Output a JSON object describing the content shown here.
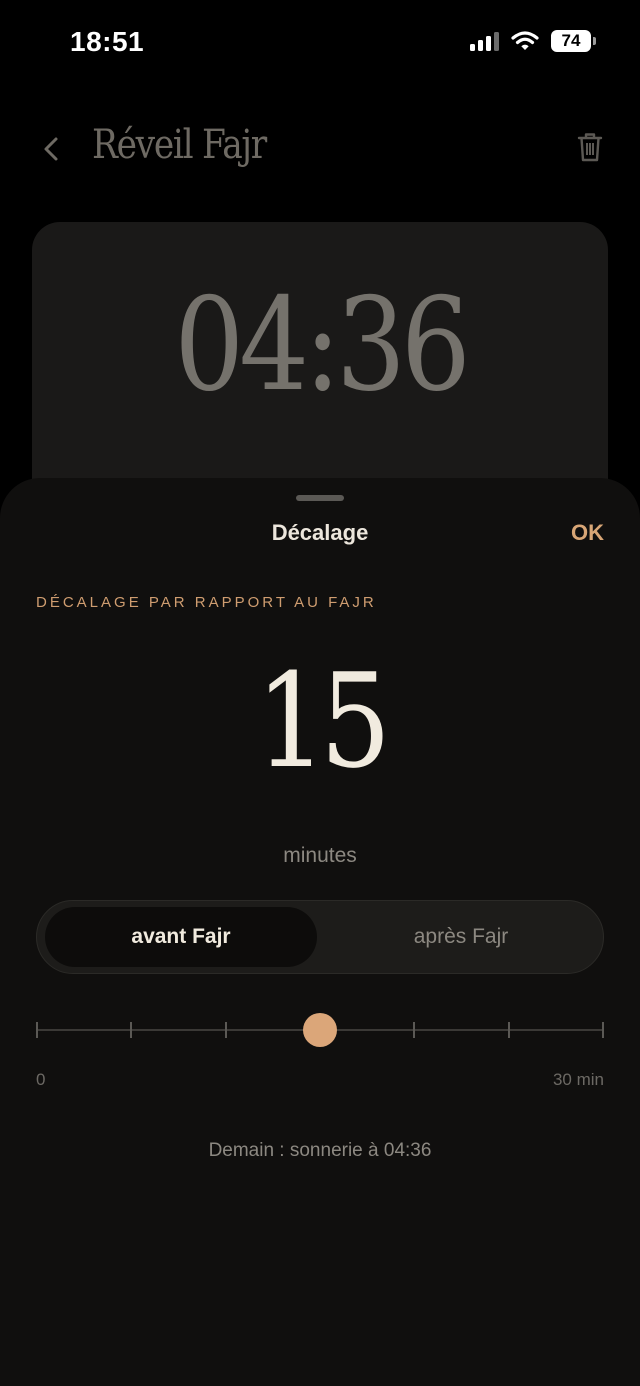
{
  "status_bar": {
    "time": "18:51",
    "battery": "74",
    "icons": [
      "cellular-signal-icon",
      "wifi-icon",
      "battery-icon"
    ]
  },
  "header": {
    "back_icon": "chevron-left-icon",
    "title": "Réveil Fajr",
    "delete_icon": "trash-icon"
  },
  "alarm": {
    "time": "04:36"
  },
  "sheet": {
    "title": "Décalage",
    "ok_label": "OK",
    "section_label": "DÉCALAGE PAR RAPPORT AU FAJR",
    "offset_value": "15",
    "unit": "minutes",
    "segments": [
      {
        "label": "avant Fajr",
        "selected": true
      },
      {
        "label": "après Fajr",
        "selected": false
      }
    ],
    "slider": {
      "min_label": "0",
      "max_label": "30 min",
      "min": 0,
      "max": 30,
      "value": 15,
      "tick_count": 7
    },
    "footer": "Demain : sonnerie à 04:36"
  },
  "colors": {
    "background": "#000000",
    "sheet": "#100f0e",
    "accent": "#d8a676",
    "text_primary": "#f1ebdf",
    "text_secondary": "#8c8881"
  }
}
